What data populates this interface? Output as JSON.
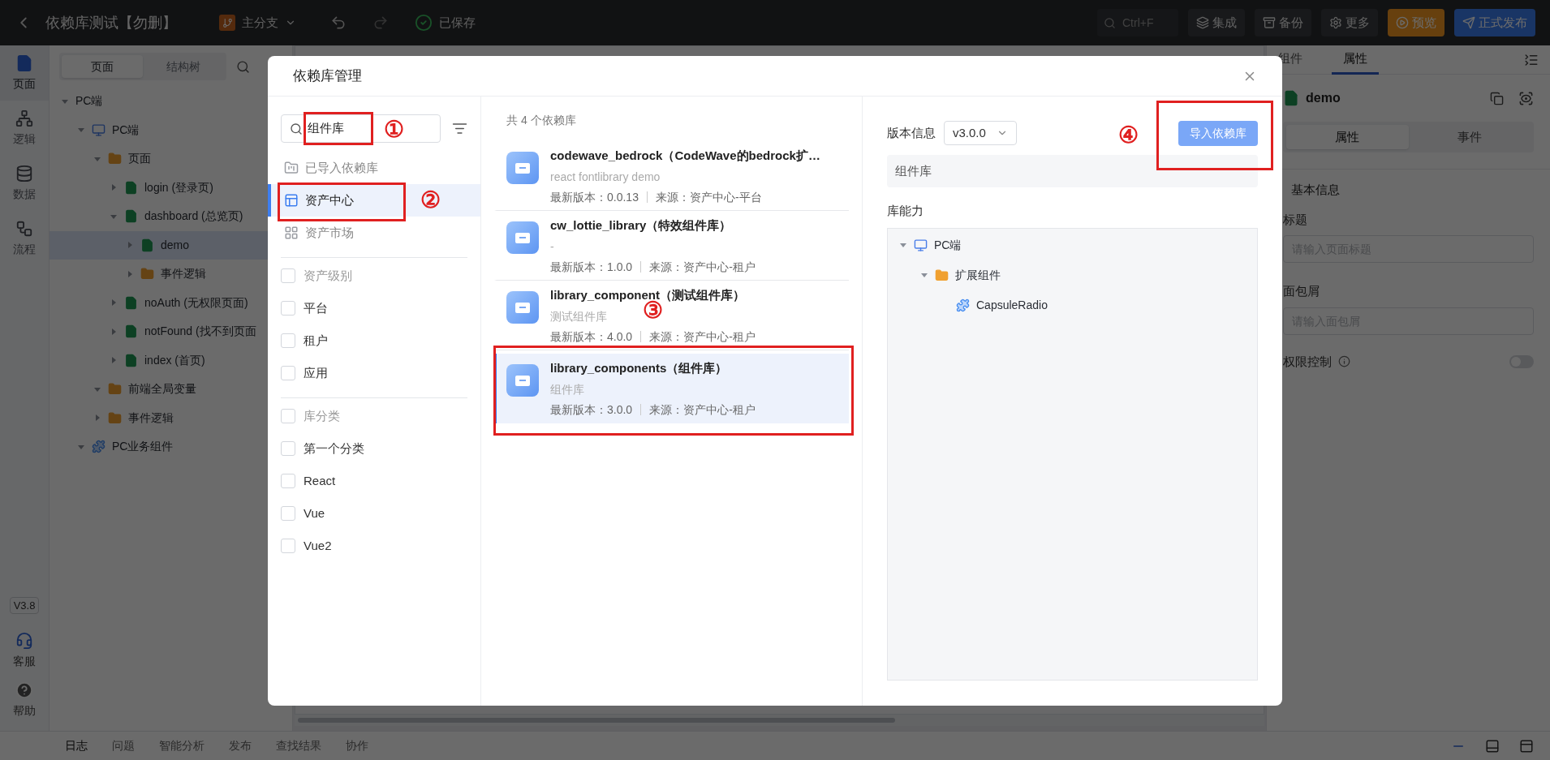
{
  "app_bar": {
    "title": "依赖库测试【勿删】",
    "branch": "主分支",
    "save_status": "已保存",
    "search_placeholder": "Ctrl+F",
    "buttons": [
      {
        "label": "集成",
        "kind": "plain"
      },
      {
        "label": "备份",
        "kind": "plain"
      },
      {
        "label": "更多",
        "kind": "plain"
      },
      {
        "label": "预览",
        "kind": "preview"
      },
      {
        "label": "正式发布",
        "kind": "publish"
      }
    ]
  },
  "nav_rail": {
    "items": [
      {
        "label": "页面",
        "selected": true
      },
      {
        "label": "逻辑",
        "selected": false
      },
      {
        "label": "数据",
        "selected": false
      },
      {
        "label": "流程",
        "selected": false
      }
    ],
    "version": "V3.8",
    "footer_items": [
      "客服",
      "帮助"
    ]
  },
  "tree_panel": {
    "tabs": [
      {
        "label": "页面",
        "selected": true
      },
      {
        "label": "结构树",
        "selected": false
      }
    ],
    "tree": [
      {
        "label": "PC端",
        "expanded": true,
        "selected": false,
        "children": [
          {
            "label": "PC端",
            "kind": "pc",
            "expanded": true,
            "selected": false,
            "children": [
              {
                "label": "页面",
                "kind": "folder",
                "expanded": true,
                "selected": false,
                "children": [
                  {
                    "label": "login (登录页)",
                    "kind": "page",
                    "expanded": false,
                    "selected": false
                  },
                  {
                    "label": "dashboard (总览页)",
                    "kind": "page",
                    "expanded": true,
                    "selected": false,
                    "children": [
                      {
                        "label": "demo",
                        "kind": "page",
                        "expanded": false,
                        "selected": true
                      },
                      {
                        "label": "事件逻辑",
                        "kind": "folder",
                        "expanded": false,
                        "selected": false
                      }
                    ]
                  },
                  {
                    "label": "noAuth (无权限页面)",
                    "kind": "page",
                    "expanded": false,
                    "selected": false
                  },
                  {
                    "label": "notFound (找不到页面",
                    "kind": "page",
                    "expanded": false,
                    "selected": false
                  },
                  {
                    "label": "index (首页)",
                    "kind": "page",
                    "expanded": false,
                    "selected": false
                  }
                ]
              },
              {
                "label": "前端全局变量",
                "kind": "folder",
                "expanded": true,
                "selected": false
              },
              {
                "label": "事件逻辑",
                "kind": "folder",
                "expanded": false,
                "selected": false
              }
            ]
          },
          {
            "label": "PC业务组件",
            "kind": "component",
            "expanded": true,
            "selected": false
          }
        ]
      }
    ]
  },
  "right_panel": {
    "tabs": [
      {
        "label": "组件",
        "selected": false
      },
      {
        "label": "属性",
        "selected": true
      }
    ],
    "page_name": "demo",
    "segments": [
      {
        "label": "属性",
        "selected": true
      },
      {
        "label": "事件",
        "selected": false
      }
    ],
    "section": "基本信息",
    "fields": [
      {
        "label": "标题",
        "placeholder": "请输入页面标题"
      },
      {
        "label": "面包屑",
        "placeholder": "请输入面包屑"
      }
    ],
    "toggle": {
      "label": "权限控制",
      "on": false
    }
  },
  "bottom_tabs": [
    {
      "label": "日志",
      "selected": true
    },
    {
      "label": "问题",
      "selected": false
    },
    {
      "label": "智能分析",
      "selected": false
    },
    {
      "label": "发布",
      "selected": false
    },
    {
      "label": "查找结果",
      "selected": false
    },
    {
      "label": "协作",
      "selected": false
    }
  ],
  "dialog": {
    "title": "依赖库管理",
    "search": {
      "value": "组件库",
      "marker": "①"
    },
    "sources": [
      {
        "label": "已导入依赖库",
        "kind": "imported",
        "selected": false
      },
      {
        "label": "资产中心",
        "kind": "center",
        "selected": true,
        "marker": "②"
      },
      {
        "label": "资产市场",
        "kind": "market",
        "selected": false
      }
    ],
    "filter_groups": [
      {
        "title": "资产级别",
        "checked": false,
        "options": [
          {
            "label": "平台",
            "checked": false
          },
          {
            "label": "租户",
            "checked": false
          },
          {
            "label": "应用",
            "checked": false
          }
        ]
      },
      {
        "title": "库分类",
        "checked": false,
        "options": [
          {
            "label": "第一个分类",
            "checked": false
          },
          {
            "label": "React",
            "checked": false
          },
          {
            "label": "Vue",
            "checked": false
          },
          {
            "label": "Vue2",
            "checked": false
          }
        ]
      }
    ],
    "count_text": "共 4 个依赖库",
    "libraries": [
      {
        "name": "codewave_bedrock（CodeWave的bedrock扩…",
        "description": "react fontlibrary demo",
        "version": "最新版本：0.0.13",
        "source": "来源：资产中心-平台",
        "selected": false
      },
      {
        "name": "cw_lottie_library（特效组件库）",
        "description": "-",
        "version": "最新版本：1.0.0",
        "source": "来源：资产中心-租户",
        "selected": false
      },
      {
        "name": "library_component（测试组件库）",
        "description": "测试组件库",
        "version": "最新版本：4.0.0",
        "source": "来源：资产中心-租户",
        "selected": false
      },
      {
        "name": "library_components（组件库）",
        "description": "组件库",
        "version": "最新版本：3.0.0",
        "source": "来源：资产中心-租户",
        "selected": true,
        "marker": "③"
      }
    ],
    "detail": {
      "version_label": "版本信息",
      "version": "v3.0.0",
      "description": "组件库",
      "import_button": "导入依赖库",
      "import_marker": "④",
      "capability_label": "库能力",
      "capability_tree": [
        {
          "label": "PC端",
          "kind": "pc",
          "expanded": true,
          "children": [
            {
              "label": "扩展组件",
              "kind": "folder",
              "expanded": true,
              "children": [
                {
                  "label": "CapsuleRadio",
                  "kind": "component"
                }
              ]
            }
          ]
        }
      ]
    }
  }
}
